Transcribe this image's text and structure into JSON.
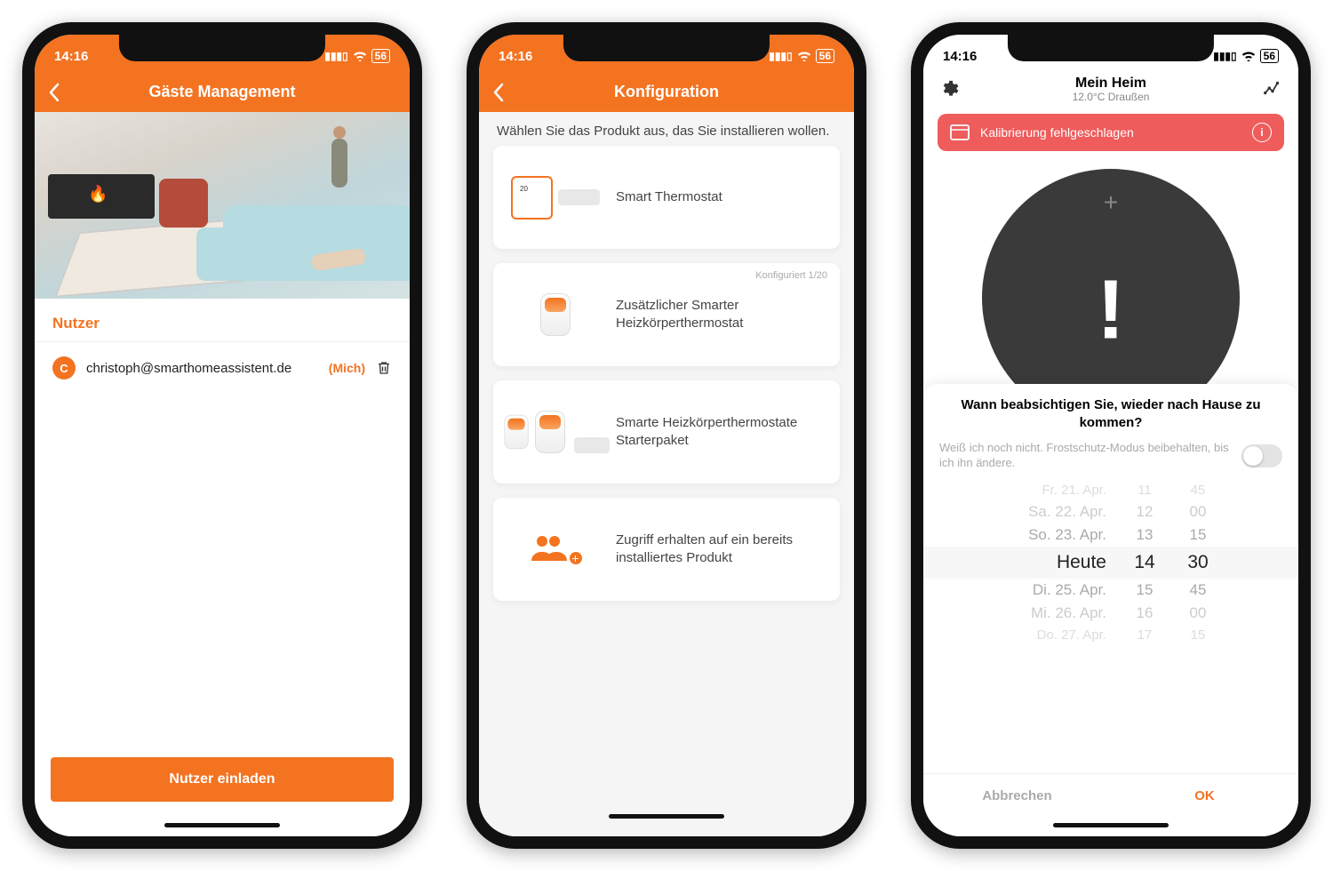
{
  "status": {
    "time": "14:16",
    "battery": "56"
  },
  "screen1": {
    "title": "Gäste Management",
    "section": "Nutzer",
    "user": {
      "initial": "C",
      "email": "christoph@smarthomeassistent.de",
      "me_tag": "(Mich)"
    },
    "invite_button": "Nutzer einladen"
  },
  "screen2": {
    "title": "Konfiguration",
    "instruction": "Wählen Sie das Produkt aus, das Sie installieren wollen.",
    "cards": [
      {
        "label": "Smart Thermostat",
        "badge": ""
      },
      {
        "label": "Zusätzlicher Smarter Heizkörperthermostat",
        "badge": "Konfiguriert 1/20"
      },
      {
        "label": "Smarte Heizkörperthermostate Starterpaket",
        "badge": ""
      },
      {
        "label": "Zugriff erhalten auf ein bereits installiertes Produkt",
        "badge": ""
      }
    ]
  },
  "screen3": {
    "home_name": "Mein Heim",
    "outside": "12.0°C Draußen",
    "error_banner": "Kalibrierung fehlgeschlagen",
    "question": "Wann beabsichtigen Sie, wieder nach Hause zu kommen?",
    "toggle_text": "Weiß ich noch nicht. Frostschutz-Modus beibehalten, bis ich ihn ändere.",
    "picker_rows": [
      {
        "d": "Fr. 21. Apr.",
        "h": "11",
        "m": "45"
      },
      {
        "d": "Sa. 22. Apr.",
        "h": "12",
        "m": "00"
      },
      {
        "d": "So. 23. Apr.",
        "h": "13",
        "m": "15"
      },
      {
        "d": "Heute",
        "h": "14",
        "m": "30"
      },
      {
        "d": "Di. 25. Apr.",
        "h": "15",
        "m": "45"
      },
      {
        "d": "Mi. 26. Apr.",
        "h": "16",
        "m": "00"
      },
      {
        "d": "Do. 27. Apr.",
        "h": "17",
        "m": "15"
      }
    ],
    "cancel": "Abbrechen",
    "ok": "OK"
  }
}
